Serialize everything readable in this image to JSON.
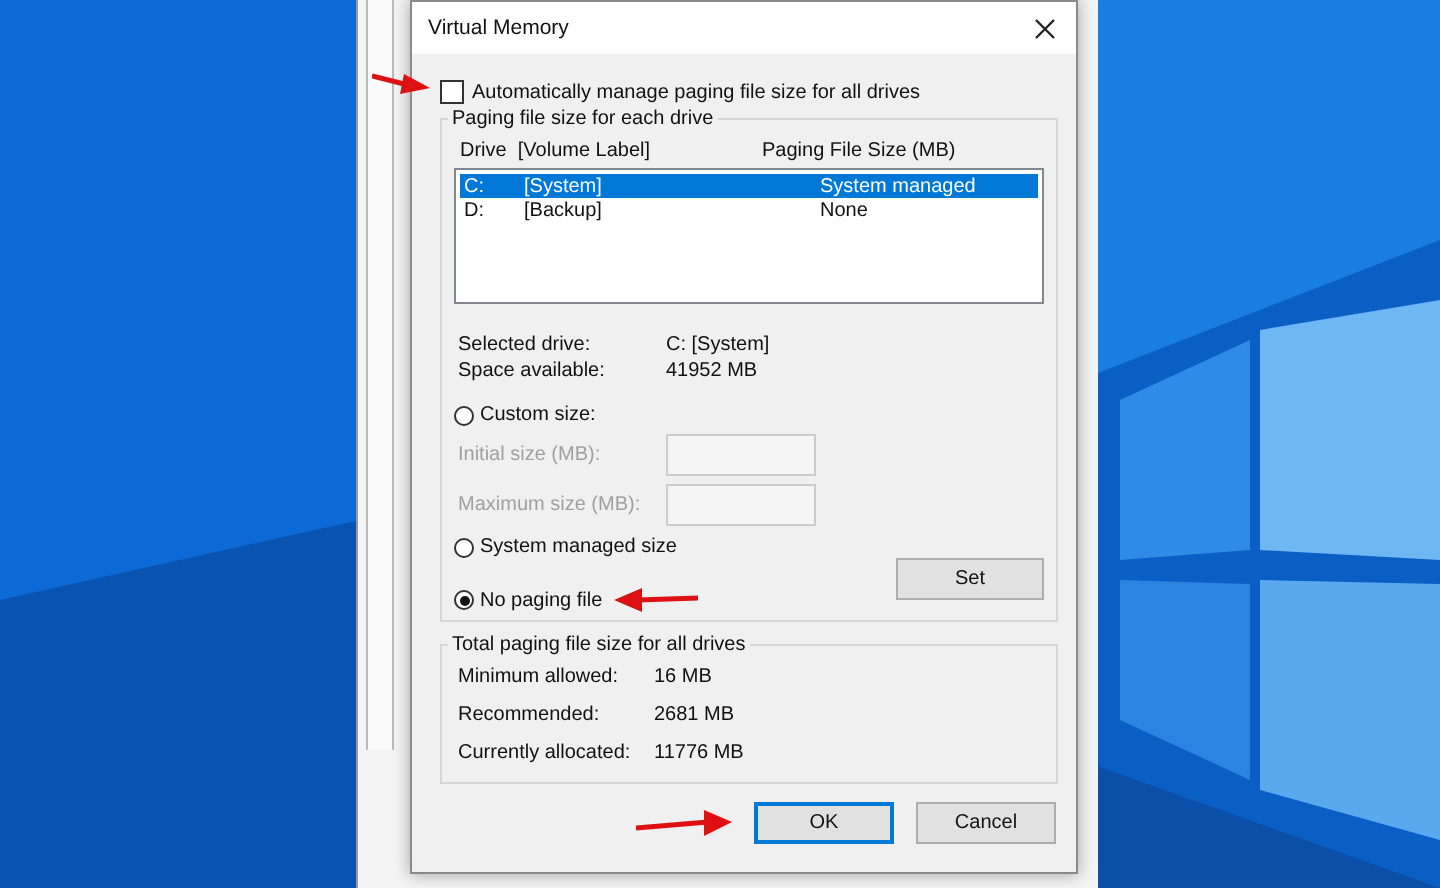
{
  "window": {
    "title": "Virtual Memory"
  },
  "auto_manage": {
    "label": "Automatically manage paging file size for all drives",
    "checked": false
  },
  "drives_group": {
    "title": "Paging file size for each drive",
    "columns": [
      "Drive  [Volume Label]",
      "Paging File Size (MB)"
    ],
    "rows": [
      {
        "drive": "C:",
        "label": "[System]",
        "size": "System managed",
        "selected": true
      },
      {
        "drive": "D:",
        "label": "[Backup]",
        "size": "None",
        "selected": false
      }
    ],
    "info": [
      {
        "label": "Selected drive:",
        "value": "C:  [System]"
      },
      {
        "label": "Space available:",
        "value": "41952 MB"
      }
    ],
    "custom": {
      "label": "Custom size:",
      "selected": false
    },
    "fields": [
      {
        "label": "Initial size (MB):",
        "disabled": true
      },
      {
        "label": "Maximum size (MB):",
        "disabled": true
      }
    ],
    "system_managed": {
      "label": "System managed size",
      "selected": false
    },
    "no_paging": {
      "label": "No paging file",
      "selected": true
    },
    "set_button": "Set"
  },
  "totals_group": {
    "title": "Total paging file size for all drives",
    "rows": [
      {
        "label": "Minimum allowed:",
        "value": "16 MB"
      },
      {
        "label": "Recommended:",
        "value": "2681 MB"
      },
      {
        "label": "Currently allocated:",
        "value": "11776 MB"
      }
    ]
  },
  "buttons": [
    {
      "label": "OK",
      "default": true
    },
    {
      "label": "Cancel",
      "default": false
    }
  ]
}
